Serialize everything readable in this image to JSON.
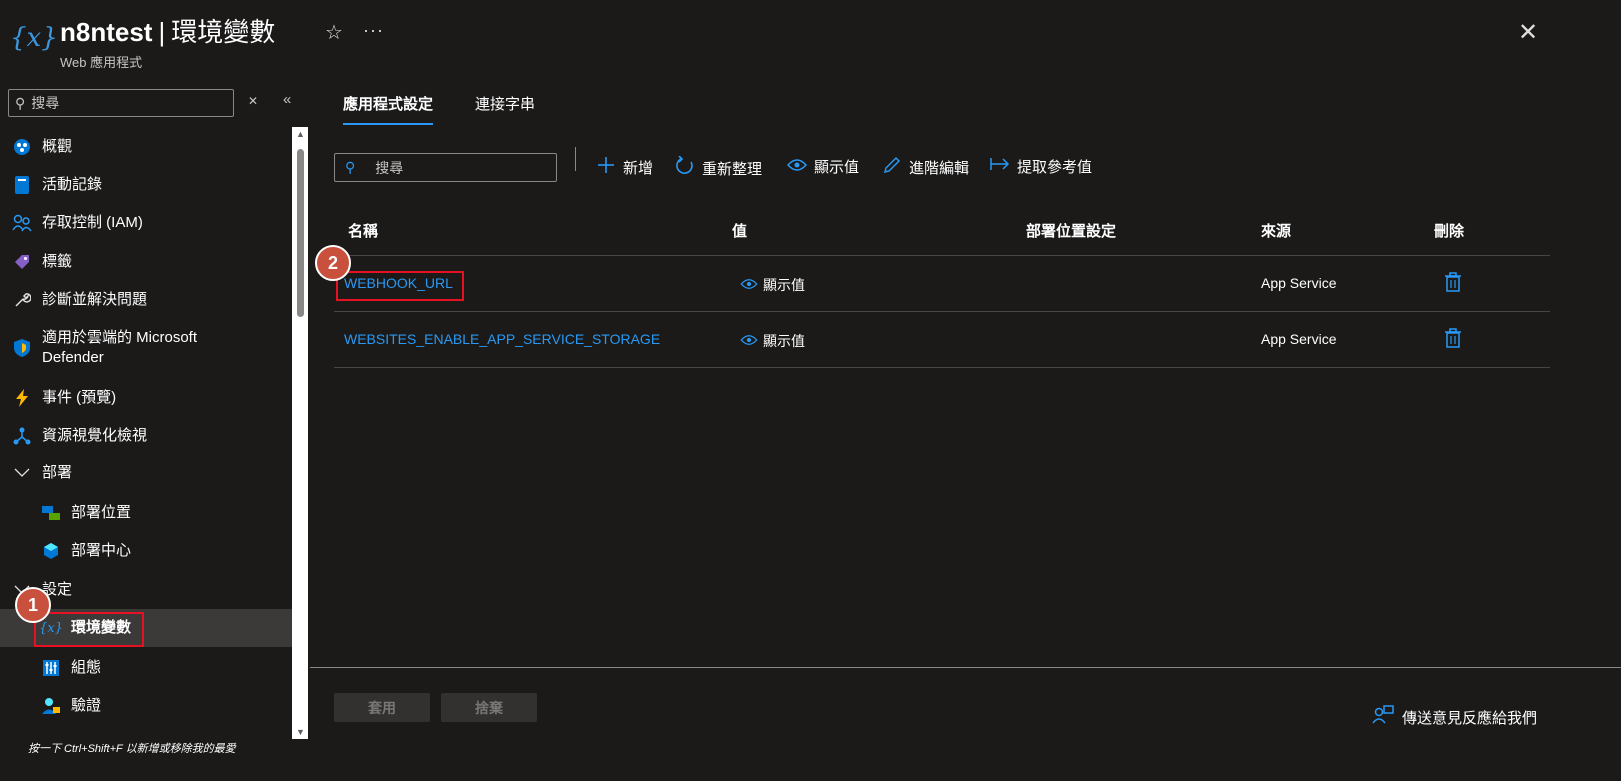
{
  "header": {
    "resource_name": "n8ntest",
    "separator": "|",
    "page_name": "環境變數",
    "subtitle": "Web 應用程式",
    "app_icon": "{x}",
    "star_icon": "☆",
    "more_icon": "···",
    "close_icon": "✕"
  },
  "sidebar": {
    "search_placeholder": "搜尋",
    "clear_icon": "✕",
    "collapse_icon": "«",
    "hint": "按一下 Ctrl+Shift+F 以新增或移除我的最愛",
    "items": [
      {
        "label": "概觀",
        "icon": "overview-icon"
      },
      {
        "label": "活動記錄",
        "icon": "activity-log-icon"
      },
      {
        "label": "存取控制 (IAM)",
        "icon": "iam-icon"
      },
      {
        "label": "標籤",
        "icon": "tag-icon"
      },
      {
        "label": "診斷並解決問題",
        "icon": "wrench-icon"
      },
      {
        "label": "適用於雲端的 Microsoft\nDefender",
        "icon": "shield-icon"
      },
      {
        "label": "事件 (預覽)",
        "icon": "lightning-icon"
      },
      {
        "label": "資源視覺化檢視",
        "icon": "visualizer-icon"
      },
      {
        "label": "部署",
        "icon": "chevron-down-icon"
      },
      {
        "label": "部署位置",
        "icon": "deployment-slots-icon"
      },
      {
        "label": "部署中心",
        "icon": "deployment-center-icon"
      },
      {
        "label": "設定",
        "icon": "chevron-down-icon"
      },
      {
        "label": "環境變數",
        "icon": "variable-icon"
      },
      {
        "label": "組態",
        "icon": "configuration-icon"
      },
      {
        "label": "驗證",
        "icon": "authentication-icon"
      }
    ]
  },
  "main": {
    "tabs": [
      {
        "label": "應用程式設定",
        "active": true
      },
      {
        "label": "連接字串",
        "active": false
      }
    ],
    "search_placeholder": "搜尋",
    "toolbar": {
      "add": "新增",
      "refresh": "重新整理",
      "show_values": "顯示值",
      "advanced_edit": "進階編輯",
      "pull_reference": "提取參考值"
    },
    "table": {
      "headers": [
        "名稱",
        "值",
        "部署位置設定",
        "來源",
        "刪除"
      ],
      "rows": [
        {
          "name": "WEBHOOK_URL",
          "value": "顯示值",
          "slot_setting": "",
          "source": "App Service"
        },
        {
          "name": "WEBSITES_ENABLE_APP_SERVICE_STORAGE",
          "value": "顯示值",
          "slot_setting": "",
          "source": "App Service"
        }
      ]
    },
    "footer": {
      "apply": "套用",
      "discard": "捨棄",
      "feedback": "傳送意見反應給我們"
    }
  },
  "annotations": {
    "badge1": "1",
    "badge2": "2",
    "highlight_color": "#e81123",
    "badge_color": "#c8503c"
  },
  "colors": {
    "background": "#1b1a19",
    "accent": "#2899f5",
    "active_nav": "#3b3a39"
  }
}
